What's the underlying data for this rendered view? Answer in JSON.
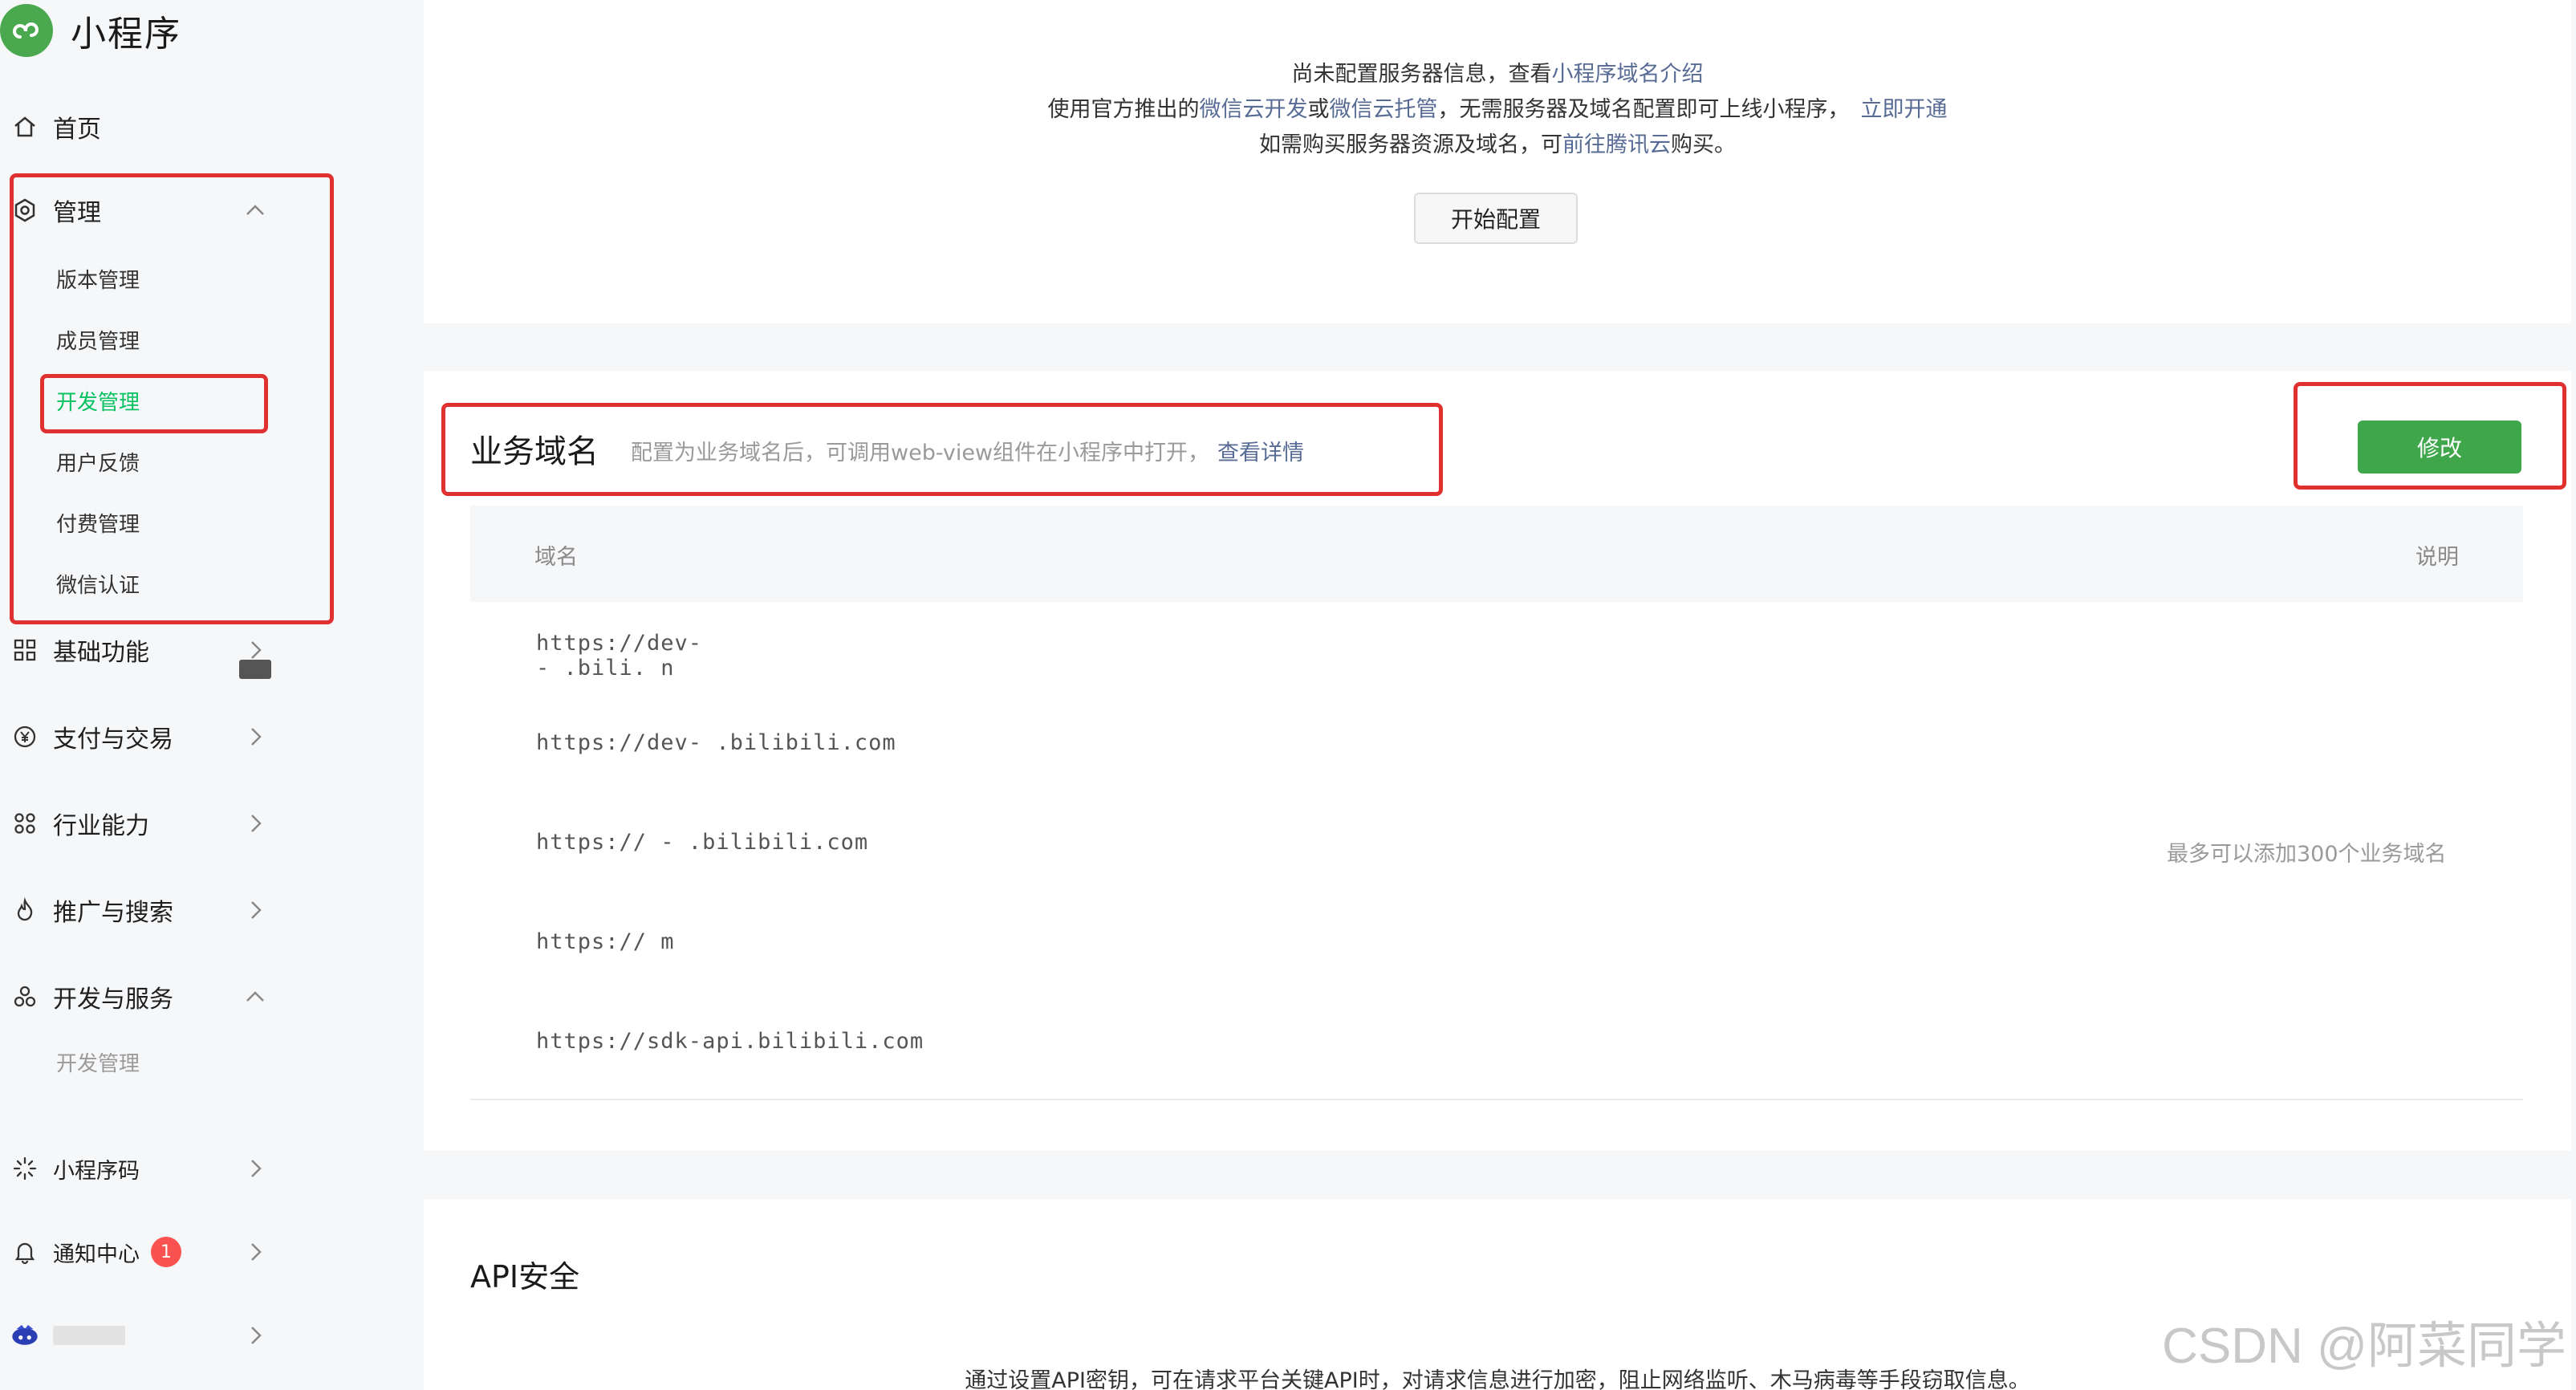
{
  "app": {
    "title": "小程序"
  },
  "sidebar": {
    "home": "首页",
    "manage": "管理",
    "manage_items": [
      "版本管理",
      "成员管理",
      "开发管理",
      "用户反馈",
      "付费管理",
      "微信认证"
    ],
    "basic": "基础功能",
    "pay": "支付与交易",
    "industry": "行业能力",
    "promo": "推广与搜索",
    "devsvc": "开发与服务",
    "devsvc_items": [
      "开发管理"
    ],
    "qrcode": "小程序码",
    "notify": "通知中心",
    "notify_badge": "1"
  },
  "server_notice": {
    "line1_prefix": "尚未配置服务器信息，查看",
    "line1_link": "小程序域名介绍",
    "line2_prefix": "使用官方推出的",
    "line2_link1": "微信云开发",
    "line2_or": "或",
    "line2_link2": "微信云托管",
    "line2_suffix": "，无需服务器及域名配置即可上线小程序，",
    "line2_link3": "立即开通",
    "line3_prefix": "如需购买服务器资源及域名，可",
    "line3_link": "前往腾讯云",
    "line3_suffix": "购买。",
    "button": "开始配置"
  },
  "business_domain": {
    "title": "业务域名",
    "desc": "配置为业务域名后，可调用web-view组件在小程序中打开，",
    "desc_link": "查看详情",
    "edit_button": "修改",
    "col_domain": "域名",
    "col_note": "说明",
    "rows": [
      "https://dev-  -  .bili.  n",
      "https://dev-  .bilibili.com",
      "https://  -  .bilibili.com",
      "https://  m",
      "https://sdk-api.bilibili.com"
    ],
    "note": "最多可以添加300个业务域名"
  },
  "api_security": {
    "title": "API安全",
    "desc": "通过设置API密钥，可在请求平台关键API时，对请求信息进行加密，阻止网络监听、木马病毒等手段窃取信息。"
  },
  "watermark": "CSDN @阿菜同学",
  "colors": {
    "accent_green": "#07c160",
    "button_green": "#3fa64c",
    "link_blue": "#576b95",
    "highlight_red": "#e03131",
    "badge_red": "#fa5151"
  }
}
